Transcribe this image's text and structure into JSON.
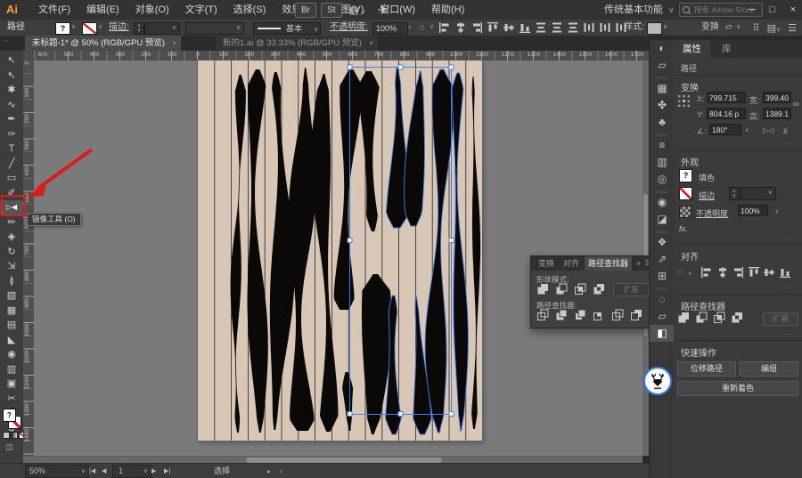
{
  "window": {
    "app": "Adobe Illustrator"
  },
  "colors": {
    "selection_blue": "#4a7de0",
    "annotation_red": "#dd1b1b",
    "artboard_beige": "#d8c7b7",
    "artwork_black": "#0b0907",
    "stripe_dark": "#27211c"
  },
  "icons": {
    "close": "×",
    "chevron_down": "∨",
    "chevron_right": "›",
    "double_chevron": "»",
    "dots_more": "···",
    "minimize": "─",
    "maximize": "□",
    "grid_grip": "⠿",
    "menu": "☰",
    "panel_list": "▤",
    "share": "✈",
    "globe": "◍",
    "key_object": "◌",
    "fx": "fx.",
    "angle": "∠:",
    "flip_h": "▷◁",
    "flip_v": "⊻",
    "chain": "∞",
    "first": "|◀",
    "prev": "◀",
    "next": "▶",
    "last": "▶|",
    "gt": "›",
    "play": "▸",
    "lt": "‹"
  },
  "menubar": {
    "logo": "Ai",
    "menus": [
      "文件(F)",
      "编辑(E)",
      "对象(O)",
      "文字(T)",
      "选择(S)",
      "效果(C)",
      "视图(V)",
      "窗口(W)",
      "帮助(H)"
    ],
    "bridge_button": "Br",
    "stock_button": "St",
    "workspace_switcher": "传统基本功能",
    "search_placeholder": "搜索 Adobe Stock"
  },
  "control_bar": {
    "selection_label": "路径",
    "fill_unknown": "?",
    "stroke_label": "描边:",
    "brush_definition": "基本",
    "opacity_label": "不透明度:",
    "opacity_value": "100%",
    "style_label": "样式:",
    "transform_label": "变换",
    "align_icons": [
      "align-left",
      "align-h-center",
      "align-right",
      "align-top",
      "align-v-center",
      "align-bottom",
      "dist-v-top",
      "dist-v-center",
      "dist-v-bottom",
      "dist-h-left",
      "dist-h-center",
      "dist-h-right"
    ]
  },
  "tabs": [
    {
      "title": "未标题-1* @ 50% (RGB/GPU 预览)"
    },
    {
      "title": "新的1.ai @ 33.33% (RGB/GPU 预览)"
    }
  ],
  "toolbar": {
    "tools": [
      {
        "name": "selection-tool",
        "glyph": "↖"
      },
      {
        "name": "direct-selection-tool",
        "glyph": "↖"
      },
      {
        "name": "magic-wand-tool",
        "glyph": "✱"
      },
      {
        "name": "lasso-tool",
        "glyph": "∿"
      },
      {
        "name": "pen-tool",
        "glyph": "✒"
      },
      {
        "name": "curvature-tool",
        "glyph": "✑"
      },
      {
        "name": "type-tool",
        "glyph": "T"
      },
      {
        "name": "line-segment-tool",
        "glyph": "╱"
      },
      {
        "name": "rectangle-tool",
        "glyph": "▭"
      },
      {
        "name": "paintbrush-tool",
        "glyph": "✐"
      },
      {
        "name": "reflect-tool",
        "glyph": "▷◀",
        "highlighted": true
      },
      {
        "name": "pencil-tool",
        "glyph": "✏"
      },
      {
        "name": "shaper-tool",
        "glyph": "◈"
      },
      {
        "name": "rotate-tool",
        "glyph": "↻"
      },
      {
        "name": "scale-tool",
        "glyph": "⇲"
      },
      {
        "name": "width-tool",
        "glyph": "≬"
      },
      {
        "name": "free-transform-tool",
        "glyph": "▧"
      },
      {
        "name": "mesh-tool",
        "glyph": "▦"
      },
      {
        "name": "gradient-tool",
        "glyph": "▤"
      },
      {
        "name": "eyedropper-tool",
        "glyph": "◣"
      },
      {
        "name": "blend-tool",
        "glyph": "◉"
      },
      {
        "name": "column-graph-tool",
        "glyph": "▥"
      },
      {
        "name": "artboard-tool",
        "glyph": "▣"
      },
      {
        "name": "slice-tool",
        "glyph": "✂"
      },
      {
        "name": "hand-tool",
        "glyph": "✜"
      },
      {
        "name": "zoom-tool",
        "glyph": "Q"
      }
    ]
  },
  "tooltip": "镜像工具 (O)",
  "rulers": {
    "h": [
      "600",
      "500",
      "400",
      "300",
      "200",
      "100",
      "0",
      "100",
      "200",
      "300",
      "400",
      "500",
      "600",
      "700",
      "800",
      "900",
      "1000",
      "1100",
      "1200",
      "1300",
      "1400",
      "1500",
      "1600",
      "1700"
    ],
    "v": [
      "0",
      "100",
      "200",
      "300",
      "400",
      "500",
      "600",
      "700",
      "800",
      "900",
      "1000",
      "1100",
      "1200",
      "1300",
      "1400"
    ]
  },
  "pathfinder_panel": {
    "tabs": [
      {
        "label": "变换",
        "active": false
      },
      {
        "label": "对齐",
        "active": false
      },
      {
        "label": "路径查找器",
        "active": true
      }
    ],
    "shape_modes_label": "形状模式:",
    "shape_modes": [
      "unite",
      "minus-front",
      "intersect",
      "exclude"
    ],
    "expand_button": "扩展",
    "pathfinders_label": "路径查找器:",
    "pathfinders": [
      "divide",
      "trim",
      "merge",
      "crop",
      "outline",
      "minus-back"
    ]
  },
  "dock": {
    "groups": [
      [
        {
          "name": "color",
          "glyph": "◐"
        },
        {
          "name": "color-guide",
          "glyph": "▱"
        }
      ],
      [
        {
          "name": "swatches",
          "glyph": "▦"
        },
        {
          "name": "brushes",
          "glyph": "✤"
        },
        {
          "name": "symbols",
          "glyph": "♣"
        }
      ],
      [
        {
          "name": "stroke",
          "glyph": "≡"
        },
        {
          "name": "gradient",
          "glyph": "▥"
        },
        {
          "name": "transparency",
          "glyph": "◎"
        }
      ],
      [
        {
          "name": "appearance",
          "glyph": "◉"
        },
        {
          "name": "graphic-styles",
          "glyph": "◪"
        }
      ],
      [
        {
          "name": "layers",
          "glyph": "❖"
        },
        {
          "name": "export",
          "glyph": "⇗"
        },
        {
          "name": "asset-export",
          "glyph": "⊞"
        }
      ],
      [
        {
          "name": "align",
          "glyph": "◌"
        },
        {
          "name": "transform",
          "glyph": "▱"
        },
        {
          "name": "pathfinder",
          "glyph": "◧",
          "active": true
        }
      ]
    ]
  },
  "properties": {
    "tab_properties": "属性",
    "tab_libraries": "库",
    "selection_type": "路径",
    "transform": {
      "title": "变换",
      "x_label": "X:",
      "x_value": "799.715",
      "y_label": "Y:",
      "y_value": "804.16 p",
      "w_label": "宽:",
      "w_value": "399.405",
      "h_label": "高:",
      "h_value": "1389.153",
      "angle_value": "180°"
    },
    "appearance": {
      "title": "外观",
      "fill_label": "填色",
      "fill_swatch": "?",
      "stroke_label": "描边",
      "opacity_label": "不透明度",
      "opacity_value": "100%",
      "fx_label": "fx."
    },
    "align": {
      "title": "对齐",
      "icons": [
        "align-left",
        "align-h-center",
        "align-right",
        "align-top",
        "align-v-center",
        "align-bottom"
      ]
    },
    "pathfinder": {
      "title": "路径查找器",
      "icons": [
        "unite",
        "minus-front",
        "intersect",
        "exclude"
      ],
      "expand_button": "扩展"
    },
    "quick_actions": {
      "title": "快速操作",
      "offset_path": "位移路径",
      "group": "编组",
      "recolor": "重新着色"
    }
  },
  "status_bar": {
    "zoom": "50%",
    "artboard_nav": "1",
    "status": "选择"
  }
}
